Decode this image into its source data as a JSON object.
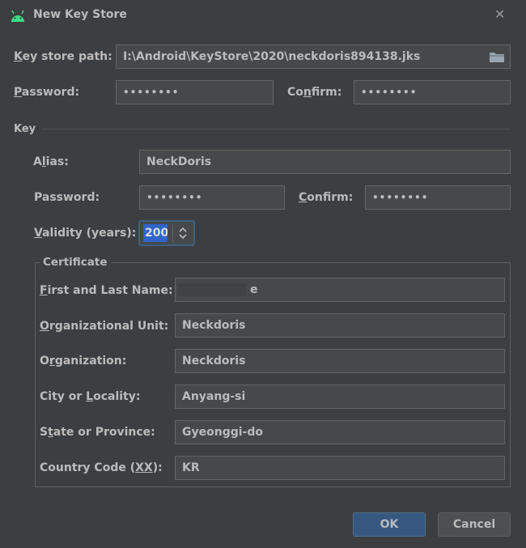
{
  "window": {
    "title": "New Key Store",
    "close_glyph": "✕"
  },
  "keystore": {
    "path_label_u": "K",
    "path_label_rest": "ey store path:",
    "path_value": "I:\\Android\\KeyStore\\2020\\neckdoris894138.jks",
    "password_label_u": "P",
    "password_label_rest": "assword:",
    "password_value": "••••••••",
    "confirm_label_pre": "Co",
    "confirm_label_u": "n",
    "confirm_label_rest": "firm:",
    "confirm_value": "••••••••"
  },
  "key": {
    "section_label": "Key",
    "alias_label_pre": "A",
    "alias_label_u": "l",
    "alias_label_rest": "ias:",
    "alias_value": "NeckDoris",
    "password_label": "Password:",
    "password_value": "••••••••",
    "confirm_label_u": "C",
    "confirm_label_rest": "onfirm:",
    "confirm_value": "••••••••",
    "validity_label_u": "V",
    "validity_label_rest": "alidity (years):",
    "validity_value": "200"
  },
  "certificate": {
    "legend": "Certificate",
    "first_last_label_u": "F",
    "first_last_label_rest": "irst and Last Name:",
    "first_last_value": "e",
    "org_unit_label_u": "O",
    "org_unit_label_rest": "rganizational Unit:",
    "org_unit_value": "Neckdoris",
    "org_label_pre": "O",
    "org_label_u": "r",
    "org_label_rest": "ganization:",
    "org_value": "Neckdoris",
    "city_label_pre": "City or ",
    "city_label_u": "L",
    "city_label_rest": "ocality:",
    "city_value": "Anyang-si",
    "state_label_pre": "S",
    "state_label_u": "t",
    "state_label_rest": "ate or Province:",
    "state_value": "Gyeonggi-do",
    "country_label_pre": "Country Code (",
    "country_label_u": "XX",
    "country_label_rest": "):",
    "country_value": "KR"
  },
  "buttons": {
    "ok": "OK",
    "cancel": "Cancel"
  },
  "colors": {
    "background": "#3c3f41",
    "field": "#45494a",
    "field_border": "#646464",
    "text": "#bbbbbb",
    "accent_button": "#365880",
    "android_green": "#3ddc84",
    "selection": "#2f65ca"
  },
  "icons": {
    "app": "android-icon",
    "close": "close-icon",
    "browse": "folder-icon",
    "spinner": "spinner-arrows-icon"
  }
}
